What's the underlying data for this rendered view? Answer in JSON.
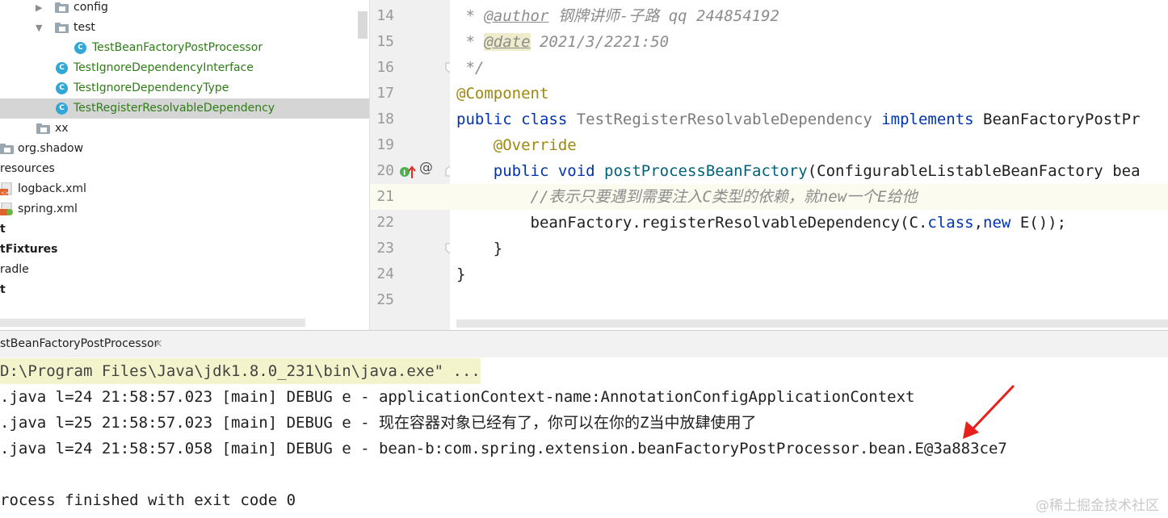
{
  "tree": {
    "items": [
      {
        "label": "config"
      },
      {
        "label": "test"
      },
      {
        "label": "TestBeanFactoryPostProcessor"
      },
      {
        "label": "TestIgnoreDependencyInterface"
      },
      {
        "label": "TestIgnoreDependencyType"
      },
      {
        "label": "TestRegisterResolvableDependency"
      },
      {
        "label": "xx"
      },
      {
        "label": "org.shadow"
      },
      {
        "label": "resources"
      },
      {
        "label": "logback.xml"
      },
      {
        "label": "spring.xml"
      },
      {
        "label": "t"
      },
      {
        "label": "tFixtures"
      },
      {
        "label": "radle"
      },
      {
        "label": "t"
      }
    ]
  },
  "editor": {
    "line_numbers": [
      "14",
      "15",
      "16",
      "17",
      "18",
      "19",
      "20",
      "21",
      "22",
      "23",
      "24",
      "25"
    ],
    "code": {
      "l14_star": " * ",
      "l14_tag": "@author",
      "l14_text": " 钢牌讲师-子路 qq 244854192",
      "l15_star": " * ",
      "l15_tag": "@date",
      "l15_text": " 2021/3/2221:50",
      "l16": " */",
      "l17": "@Component",
      "l18_kw1": "public class ",
      "l18_cls": "TestRegisterResolvableDependency",
      "l18_kw2": " implements ",
      "l18_iface": "BeanFactoryPostPr",
      "l19": "    @Override",
      "l20_kw": "    public void ",
      "l20_fn": "postProcessBeanFactory",
      "l20_rest": "(ConfigurableListableBeanFactory bea",
      "l21": "        //表示只要遇到需要注入C类型的依赖，就new一个E给他",
      "l22_a": "        beanFactory.registerResolvableDependency(C.",
      "l22_kw1": "class",
      "l22_b": ",",
      "l22_kw2": "new",
      "l22_c": " E());",
      "l23": "    }",
      "l24": "}"
    }
  },
  "run": {
    "tab_label": "stBeanFactoryPostProcessor",
    "close": "×"
  },
  "console": {
    "lines": [
      "D:\\Program Files\\Java\\jdk1.8.0_231\\bin\\java.exe\" ...",
      ".java l=24 21:58:57.023 [main] DEBUG e - applicationContext-name:AnnotationConfigApplicationContext",
      ".java l=25 21:58:57.023 [main] DEBUG e - 现在容器对象已经有了，你可以在你的Z当中放肆使用了",
      ".java l=24 21:58:57.058 [main] DEBUG e - bean-b:com.spring.extension.beanFactoryPostProcessor.bean.E@3a883ce7",
      "",
      "rocess finished with exit code 0"
    ]
  },
  "watermark": "@稀土掘金技术社区",
  "colors": {
    "keyword": "#0033b3",
    "annotation": "#9e880d",
    "comment": "#8c8c8c",
    "method": "#00627a",
    "arrow": "#e8201c"
  }
}
